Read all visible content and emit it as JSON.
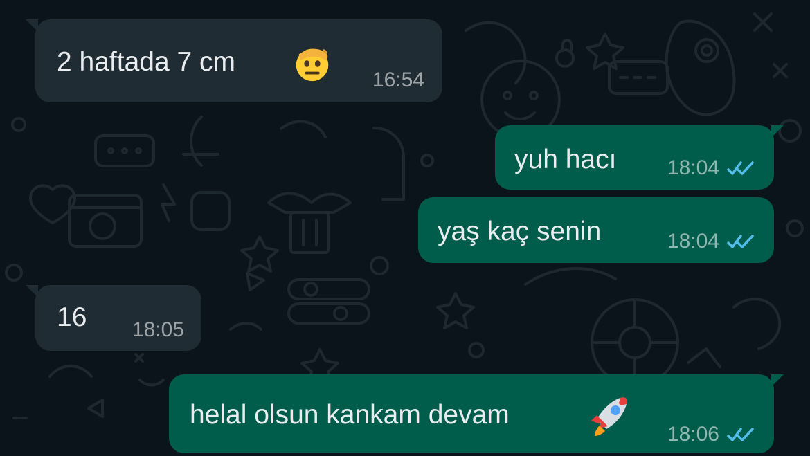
{
  "theme": {
    "background": "#0b141a",
    "incoming_bubble": "#202c33",
    "outgoing_bubble": "#005c4b",
    "text": "#e9edef",
    "read_tick": "#53bdeb"
  },
  "messages": [
    {
      "direction": "incoming",
      "text": "2 haftada 7 cm",
      "emoji": "saluting-face-icon",
      "time": "16:54"
    },
    {
      "direction": "outgoing",
      "text": "yuh hacı",
      "time": "18:04",
      "status": "read-double-check"
    },
    {
      "direction": "outgoing",
      "text": "yaş kaç senin",
      "time": "18:04",
      "status": "read-double-check"
    },
    {
      "direction": "incoming",
      "text": "16",
      "time": "18:05"
    },
    {
      "direction": "outgoing",
      "text": "helal olsun kankam devam",
      "emoji": "rocket-icon",
      "time": "18:06",
      "status": "read-double-check"
    }
  ]
}
